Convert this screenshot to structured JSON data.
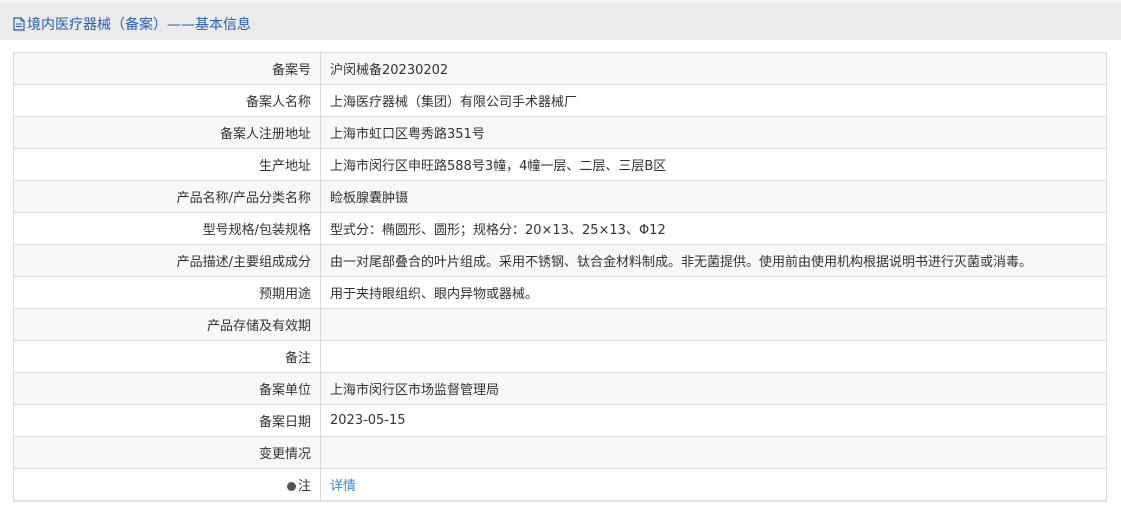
{
  "header": {
    "title": "境内医疗器械（备案）——基本信息",
    "icon": "document-icon"
  },
  "rows": [
    {
      "label": "备案号",
      "value": "沪闵械备20230202"
    },
    {
      "label": "备案人名称",
      "value": "上海医疗器械（集团）有限公司手术器械厂"
    },
    {
      "label": "备案人注册地址",
      "value": "上海市虹口区粤秀路351号"
    },
    {
      "label": "生产地址",
      "value": "上海市闵行区申旺路588号3幢，4幢一层、二层、三层B区"
    },
    {
      "label": "产品名称/产品分类名称",
      "value": "睑板腺囊肿镊"
    },
    {
      "label": "型号规格/包装规格",
      "value": "型式分：椭圆形、圆形；规格分：20×13、25×13、Φ12"
    },
    {
      "label": "产品描述/主要组成成分",
      "value": "由一对尾部叠合的叶片组成。采用不锈钢、钛合金材料制成。非无菌提供。使用前由使用机构根据说明书进行灭菌或消毒。"
    },
    {
      "label": "预期用途",
      "value": "用于夹持眼组织、眼内异物或器械。"
    },
    {
      "label": "产品存储及有效期",
      "value": ""
    },
    {
      "label": "备注",
      "value": ""
    },
    {
      "label": "备案单位",
      "value": "上海市闵行区市场监督管理局"
    },
    {
      "label": "备案日期",
      "value": "2023-05-15"
    },
    {
      "label": "变更情况",
      "value": ""
    }
  ],
  "note_row": {
    "label": "注",
    "link_text": "详情",
    "icon": "bulb-icon"
  },
  "colors": {
    "title": "#2a5db0",
    "link": "#3c83d6",
    "header_bg": "#ebebeb"
  }
}
